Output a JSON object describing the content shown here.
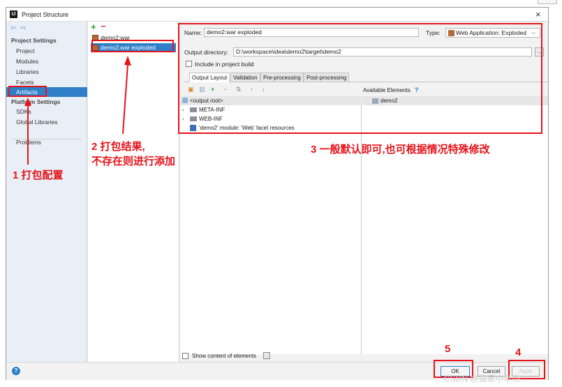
{
  "window": {
    "title": "Project Structure",
    "close": "×",
    "app_icon": "IJ"
  },
  "nav": {
    "back": "⇦",
    "forward": "⇨",
    "project_settings": "Project Settings",
    "project_items": [
      "Project",
      "Modules",
      "Libraries",
      "Facets",
      "Artifacts"
    ],
    "platform_settings": "Platform Settings",
    "platform_items": [
      "SDKs",
      "Global Libraries"
    ],
    "problems": "Problems",
    "selected": "Artifacts"
  },
  "artifacts": {
    "add": "+",
    "remove": "−",
    "items": [
      "demo2:war",
      "demo2:war exploded"
    ],
    "selected": "demo2:war exploded"
  },
  "detail": {
    "name_label": "Name:",
    "name_value": "demo2:war exploded",
    "type_label": "Type:",
    "type_value": "Web Application: Exploded",
    "output_label": "Output directory:",
    "output_value": "D:\\workspace\\idea\\demo2\\target\\demo2",
    "browse": "...",
    "include_build": "Include in project build",
    "tabs": [
      "Output Layout",
      "Validation",
      "Pre-processing",
      "Post-processing"
    ],
    "available_label": "Available Elements",
    "help": "?",
    "tree": [
      "<output root>",
      "META-INF",
      "WEB-INF",
      "'demo2' module: 'Web' facet resources"
    ],
    "available_items": [
      "demo2"
    ],
    "show_content": "Show content of elements",
    "toolbar_icons": [
      "folder-icon",
      "archive-icon",
      "add-icon",
      "remove-icon",
      "sort-icon",
      "up-icon",
      "down-icon"
    ]
  },
  "buttons": {
    "ok": "OK",
    "cancel": "Cancel",
    "apply": "Apply",
    "help": "?"
  },
  "annotations": {
    "a1": "1  打包配置",
    "a2_line1": "2  打包结果,",
    "a2_line2": "不存在则进行添加",
    "a3": "3  一般默认即可,也可根据情况特殊修改",
    "a4": "4",
    "a5": "5"
  },
  "colors": {
    "accent": "#2f7fc9",
    "annotation": "#e5141b",
    "nav_bg": "#e9eff6"
  },
  "watermark": "CSDN @猫家小辛杰"
}
